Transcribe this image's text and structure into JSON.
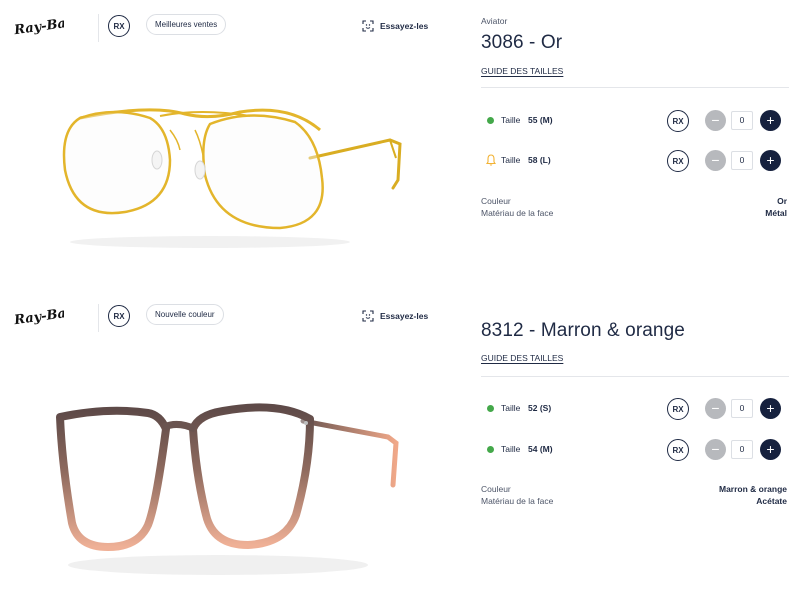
{
  "products": [
    {
      "brand": "Ray-Ban",
      "rx_label": "RX",
      "tag": "Meilleures ventes",
      "try_on": "Essayez-les",
      "subtitle": "Aviator",
      "title": "3086 - Or",
      "size_guide": "GUIDE DES TAILLES",
      "sizes": [
        {
          "label": "Taille",
          "value": "55 (M)",
          "status": "in-stock",
          "status_color": "#44a84a",
          "rx": "RX",
          "qty": "0"
        },
        {
          "label": "Taille",
          "value": "58 (L)",
          "status": "notify-bell",
          "status_color": "#f2b233",
          "rx": "RX",
          "qty": "0"
        }
      ],
      "attributes": [
        {
          "key": "Couleur",
          "value": "Or"
        },
        {
          "key": "Matériau de la face",
          "value": "Métal"
        }
      ]
    },
    {
      "brand": "Ray-Ban",
      "rx_label": "RX",
      "tag": "Nouvelle couleur",
      "try_on": "Essayez-les",
      "subtitle": "",
      "title": "8312 - Marron & orange",
      "size_guide": "GUIDE DES TAILLES",
      "sizes": [
        {
          "label": "Taille",
          "value": "52 (S)",
          "status": "in-stock",
          "status_color": "#44a84a",
          "rx": "RX",
          "qty": "0"
        },
        {
          "label": "Taille",
          "value": "54 (M)",
          "status": "in-stock",
          "status_color": "#44a84a",
          "rx": "RX",
          "qty": "0"
        }
      ],
      "attributes": [
        {
          "key": "Couleur",
          "value": "Marron & orange"
        },
        {
          "key": "Matériau de la face",
          "value": "Acétate"
        }
      ]
    }
  ],
  "icons": {
    "minus": "−",
    "plus": "+",
    "try_on_icon": "face-scan-icon",
    "in_stock_icon": "green-dot-icon",
    "notify_icon": "bell-icon"
  },
  "colors": {
    "navy": "#16213e",
    "text": "#1f2a44",
    "disabled_minus": "#b7b9bd",
    "in_stock_green": "#44a84a",
    "notify_yellow": "#f2b233",
    "gold_frame": "#e0b52a",
    "brown_frame": "#6f5650",
    "orange_frame": "#e9a58a"
  }
}
